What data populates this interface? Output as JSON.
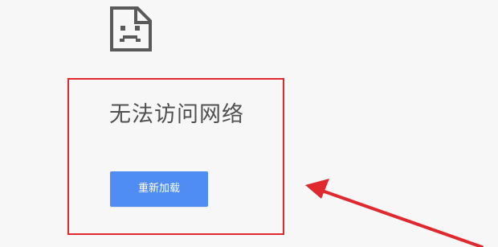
{
  "error_page": {
    "icon": "sad-page-icon",
    "title": "无法访问网络",
    "reload_label": "重新加载"
  },
  "annotation": {
    "color": "#e0292f"
  },
  "colors": {
    "background": "#f7f7f7",
    "button": "#4f8df5",
    "title_text": "#505050",
    "icon": "#5a5a5a"
  }
}
